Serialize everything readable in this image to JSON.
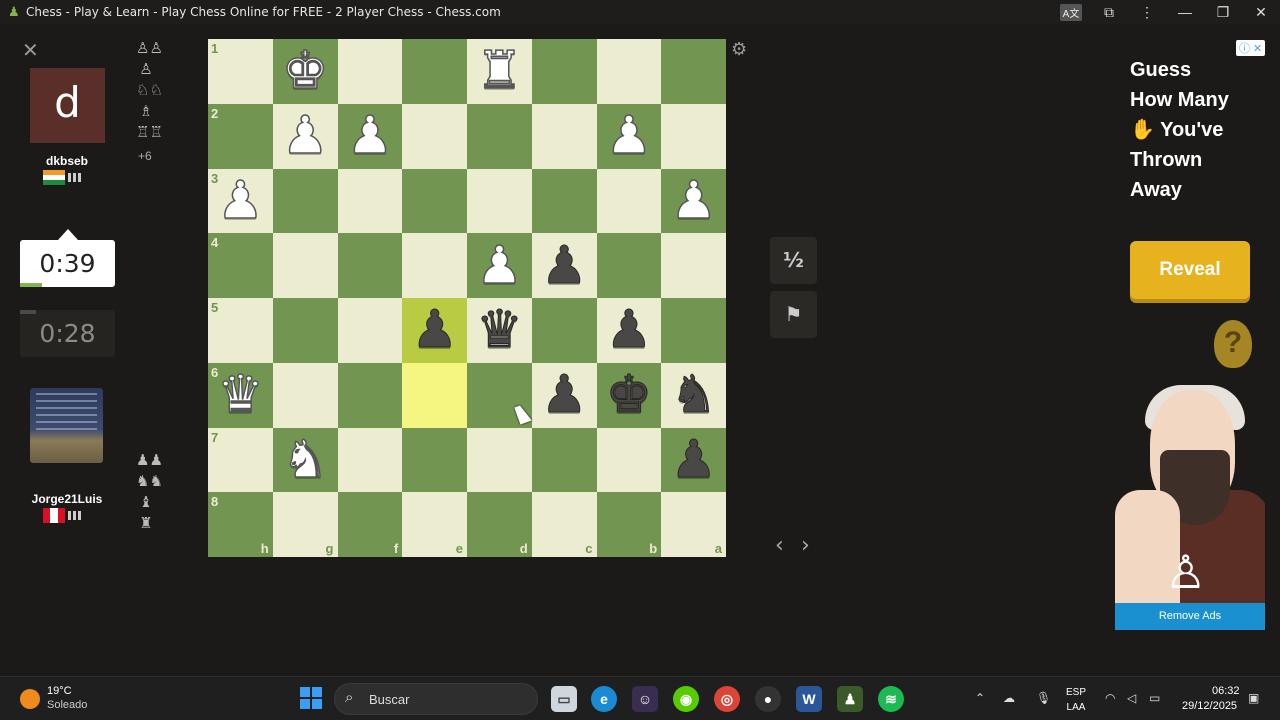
{
  "window": {
    "title": "Chess - Play & Learn - Play Chess Online for FREE - 2 Player Chess - Chess.com"
  },
  "top_player": {
    "avatar_letter": "d",
    "name": "dkbseb",
    "captured_count_label": "+6",
    "clock": "0:39",
    "clock_progress": 0.23
  },
  "bottom_player": {
    "name": "Jorge21Luis",
    "clock": "0:28",
    "clock_progress": 0.17
  },
  "board": {
    "orientation": "black",
    "ranks": [
      "1",
      "2",
      "3",
      "4",
      "5",
      "6",
      "7",
      "8"
    ],
    "files": [
      "h",
      "g",
      "f",
      "e",
      "d",
      "c",
      "b",
      "a"
    ],
    "highlight_squares": [
      "e5",
      "e6"
    ],
    "pieces": {
      "g1": "wK",
      "d1": "wR",
      "g2": "wP",
      "f2": "wP",
      "b2": "wP",
      "h3": "wP",
      "a3": "wP",
      "d4": "wP",
      "c4": "bP",
      "e5": "bP",
      "d5": "bQ",
      "b5": "bP",
      "h6": "wQ",
      "c6": "bP",
      "b6": "bK",
      "a6": "bN",
      "g7": "wN",
      "a7": "bP"
    }
  },
  "controls": {
    "draw_label": "½",
    "resign_icon": "flag-icon"
  },
  "ad": {
    "headline": [
      "Guess",
      "How Many",
      "✋ You've",
      "Thrown",
      "Away"
    ],
    "button": "Reveal",
    "remove_ads": "Remove Ads",
    "question": "?"
  },
  "taskbar": {
    "weather_temp": "19°C",
    "weather_desc": "Soleado",
    "search_placeholder": "Buscar",
    "lang_line1": "ESP",
    "lang_line2": "LAA",
    "time": "06:32",
    "date": "29/12/2025"
  },
  "colors": {
    "light_square": "#ebecd0",
    "dark_square": "#739552",
    "highlight": "#f5f682",
    "reveal_button": "#e6b31e",
    "remove_ads": "#1a90d0"
  }
}
